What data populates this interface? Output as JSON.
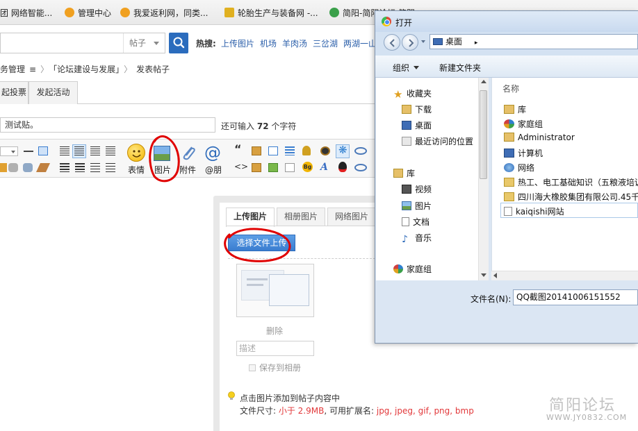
{
  "bookmarks": [
    {
      "label": "团 网络智能...",
      "color": "#3c78c3"
    },
    {
      "label": "管理中心",
      "color": "#f0a020"
    },
    {
      "label": "我爱返利网，同类...",
      "color": "#f0a020"
    },
    {
      "label": "轮胎生产与装备网 -...",
      "color": "#e0b020"
    },
    {
      "label": "简阳-简阳论坛 简阳...",
      "color": "#3aa04a"
    }
  ],
  "search": {
    "placeholder": "",
    "type_label": "帖子",
    "hot_label": "热搜:",
    "hot_links": [
      "上传图片",
      "机场",
      "羊肉汤",
      "三岔湖",
      "两湖一山"
    ]
  },
  "breadcrumb": {
    "items": [
      "务管理",
      "「论坛建设与发展」",
      "发表帖子"
    ],
    "menu_glyph": "≡",
    "sep": "〉"
  },
  "tabs": [
    "起投票",
    "发起活动"
  ],
  "subject": {
    "value": "测试贴。",
    "hint_prefix": "还可输入",
    "hint_count": "72",
    "hint_suffix": "个字符"
  },
  "toolbar": {
    "big_buttons": [
      {
        "label": "表情",
        "icon": "smiley-icon"
      },
      {
        "label": "图片",
        "icon": "image-icon"
      },
      {
        "label": "附件",
        "icon": "paperclip-icon"
      },
      {
        "label": "@朋",
        "icon": "at-icon"
      }
    ],
    "quote_glyph": "“",
    "code_glyph": "<>"
  },
  "upload": {
    "tabs": [
      "上传图片",
      "相册图片",
      "网络图片"
    ],
    "choose_button": "选择文件上传",
    "delete_label": "删除",
    "desc_placeholder": "描述",
    "save_to_album": "保存到相册",
    "tip": "点击图片添加到帖子内容中",
    "size_prefix": "文件尺寸: ",
    "size_value": "小于 2.9MB",
    "ext_prefix": ", 可用扩展名: ",
    "ext_value": "jpg, jpeg, gif, png, bmp"
  },
  "open_dialog": {
    "title": "打开",
    "address": "桌面",
    "address_arrow": "▸",
    "organize": "组织",
    "new_folder": "新建文件夹",
    "nav": {
      "favorites_header": "收藏夹",
      "favorites": [
        "下载",
        "桌面",
        "最近访问的位置"
      ],
      "libraries_header": "库",
      "libraries": [
        "视频",
        "图片",
        "文档",
        "音乐"
      ],
      "homegroup": "家庭组"
    },
    "column_name": "名称",
    "files": [
      {
        "name": "库",
        "icon": "library-icon"
      },
      {
        "name": "家庭组",
        "icon": "homegroup-icon"
      },
      {
        "name": "Administrator",
        "icon": "user-folder-icon"
      },
      {
        "name": "计算机",
        "icon": "computer-icon"
      },
      {
        "name": "网络",
        "icon": "network-icon"
      },
      {
        "name": "热工、电工基础知识（五粮液培训",
        "icon": "folder-icon"
      },
      {
        "name": "四川海大橡胶集团有限公司.45千",
        "icon": "folder-icon"
      },
      {
        "name": "kaiqishi网站",
        "icon": "file-icon"
      }
    ],
    "filename_label": "文件名(N):",
    "filename_value": "QQ截图20141006151552"
  },
  "watermark": {
    "title": "简阳论坛",
    "url": "WWW.JY0832.COM"
  },
  "colors": {
    "accent_blue": "#2b6cbd",
    "annotation_red": "#e00000",
    "limit_red": "#e2383a"
  }
}
